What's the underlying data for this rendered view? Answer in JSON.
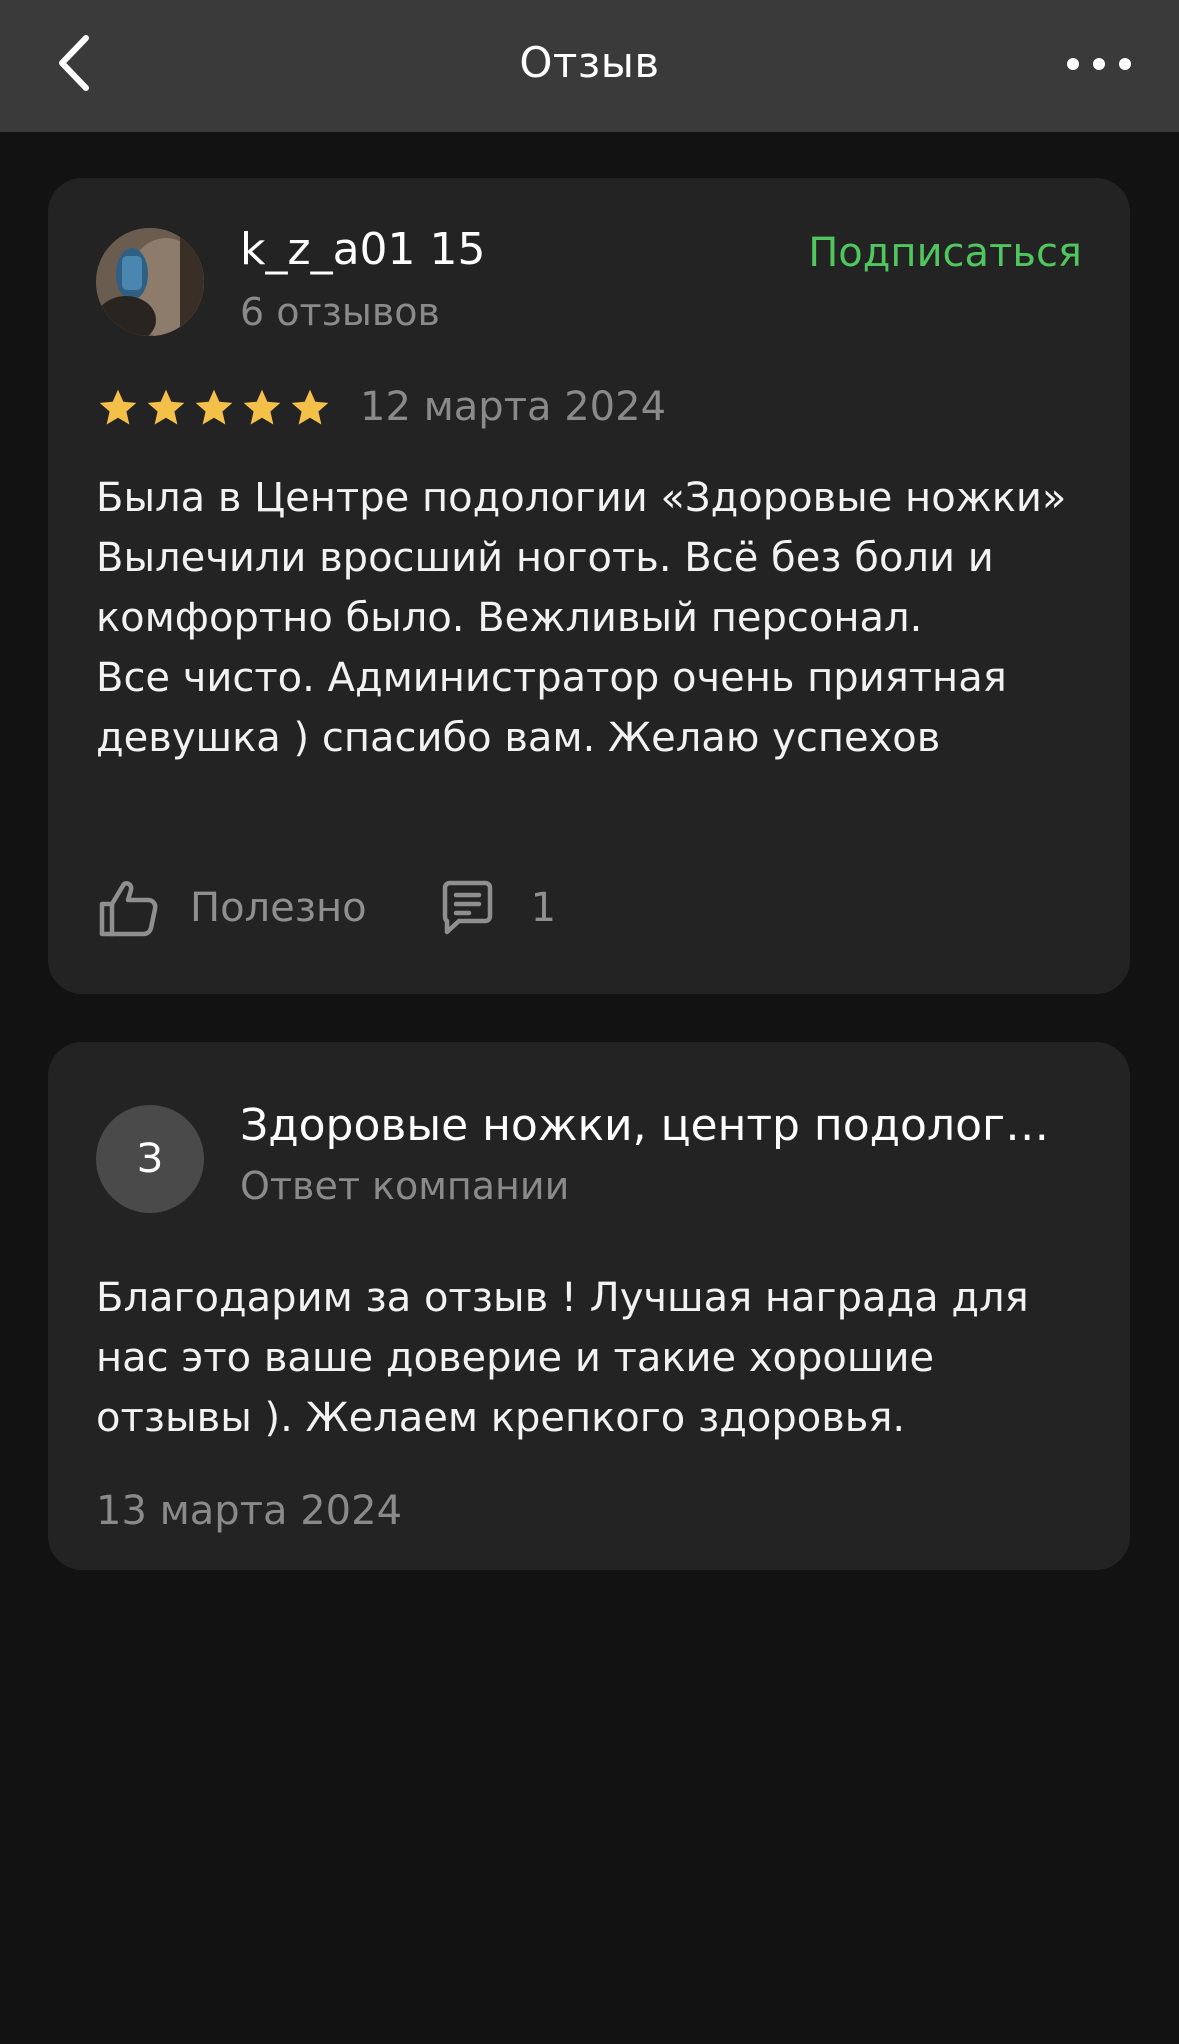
{
  "header": {
    "title": "Отзыв",
    "back_icon": "chevron-left-icon",
    "more_icon": "more-horizontal-icon"
  },
  "review": {
    "author_name": "k_z_a01 15",
    "author_meta": "6 отзывов",
    "subscribe_label": "Подписаться",
    "rating": 5,
    "rating_max": 5,
    "date": "12 марта 2024",
    "text": "Была в Центре подологии «Здоровые ножки»\nВылечили вросший ноготь. Всё без боли и комфортно было. Вежливый персонал.\nВсе чисто. Администратор очень приятная девушка ) спасибо вам. Желаю успехов",
    "like_label": "Полезно",
    "comment_count": "1"
  },
  "reply": {
    "avatar_letter": "З",
    "company_name": "Здоровые ножки, центр подологии",
    "subtitle": "Ответ компании",
    "text": "Благодарим за отзыв ! Лучшая награда для нас это ваше доверие и такие хорошие отзывы ). Желаем крепкого здоровья.",
    "date": "13 марта 2024"
  },
  "colors": {
    "background": "#121212",
    "header": "#3a3a3a",
    "card": "#232323",
    "accent_green": "#4fc65e",
    "star": "#f5c04a",
    "muted_text": "#8a8a8a"
  }
}
